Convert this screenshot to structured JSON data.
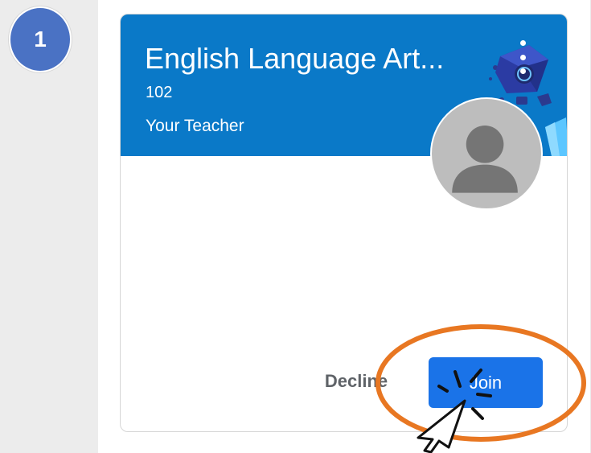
{
  "step": {
    "number": "1"
  },
  "class_card": {
    "title": "English Language Art...",
    "section": "102",
    "teacher": "Your Teacher",
    "menu_icon": "more-vert-icon",
    "avatar_icon": "person-avatar-icon",
    "header_color": "#0a79c8"
  },
  "actions": {
    "decline_label": "Decline",
    "join_label": "Join"
  },
  "annotation": {
    "highlight_color": "#e87722",
    "pointer_icon": "cursor-click-icon"
  }
}
